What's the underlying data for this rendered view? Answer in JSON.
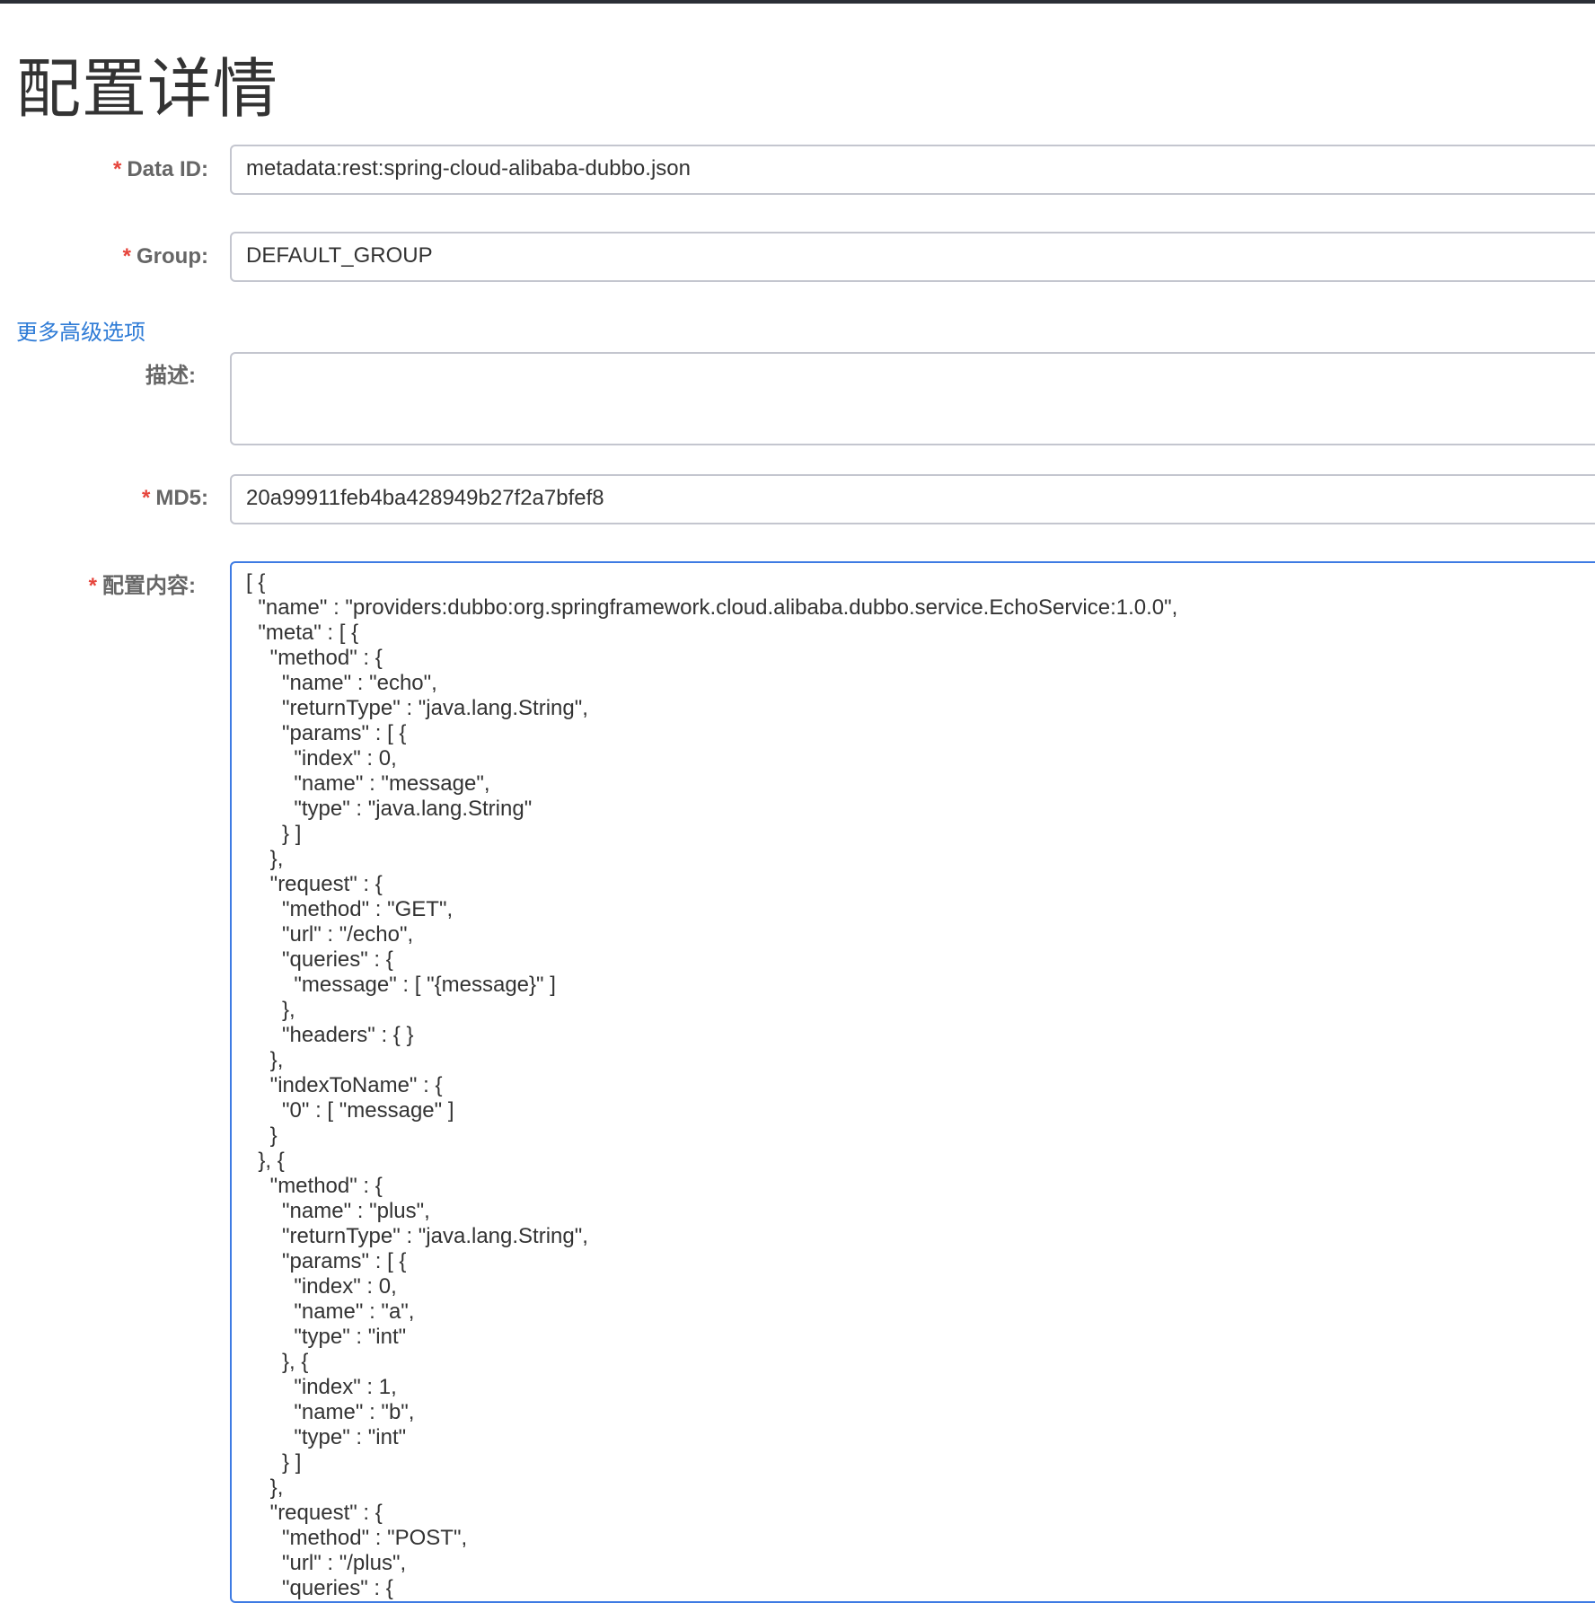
{
  "page": {
    "title": "配置详情"
  },
  "form": {
    "data_id": {
      "required_mark": "*",
      "label": "Data ID:",
      "value": "metadata:rest:spring-cloud-alibaba-dubbo.json"
    },
    "group": {
      "required_mark": "*",
      "label": "Group:",
      "value": "DEFAULT_GROUP"
    },
    "advanced_link": "更多高级选项",
    "description": {
      "label": "描述:",
      "value": ""
    },
    "md5": {
      "required_mark": "*",
      "label": "MD5:",
      "value": "20a99911feb4ba428949b27f2a7bfef8"
    },
    "content": {
      "required_mark": "*",
      "label": "配置内容:",
      "lines": [
        "[ {",
        "  \"name\" : \"providers:dubbo:org.springframework.cloud.alibaba.dubbo.service.EchoService:1.0.0\",",
        "  \"meta\" : [ {",
        "    \"method\" : {",
        "      \"name\" : \"echo\",",
        "      \"returnType\" : \"java.lang.String\",",
        "      \"params\" : [ {",
        "        \"index\" : 0,",
        "        \"name\" : \"message\",",
        "        \"type\" : \"java.lang.String\"",
        "      } ]",
        "    },",
        "    \"request\" : {",
        "      \"method\" : \"GET\",",
        "      \"url\" : \"/echo\",",
        "      \"queries\" : {",
        "        \"message\" : [ \"{message}\" ]",
        "      },",
        "      \"headers\" : { }",
        "    },",
        "    \"indexToName\" : {",
        "      \"0\" : [ \"message\" ]",
        "    }",
        "  }, {",
        "    \"method\" : {",
        "      \"name\" : \"plus\",",
        "      \"returnType\" : \"java.lang.String\",",
        "      \"params\" : [ {",
        "        \"index\" : 0,",
        "        \"name\" : \"a\",",
        "        \"type\" : \"int\"",
        "      }, {",
        "        \"index\" : 1,",
        "        \"name\" : \"b\",",
        "        \"type\" : \"int\"",
        "      } ]",
        "    },",
        "    \"request\" : {",
        "      \"method\" : \"POST\",",
        "      \"url\" : \"/plus\",",
        "      \"queries\" : {"
      ]
    }
  },
  "colors": {
    "required": "#e6453c",
    "link": "#2e7bd6",
    "focus_border": "#3e7be3",
    "input_border": "#c4c6cf",
    "top_bar": "#2b2f36"
  }
}
